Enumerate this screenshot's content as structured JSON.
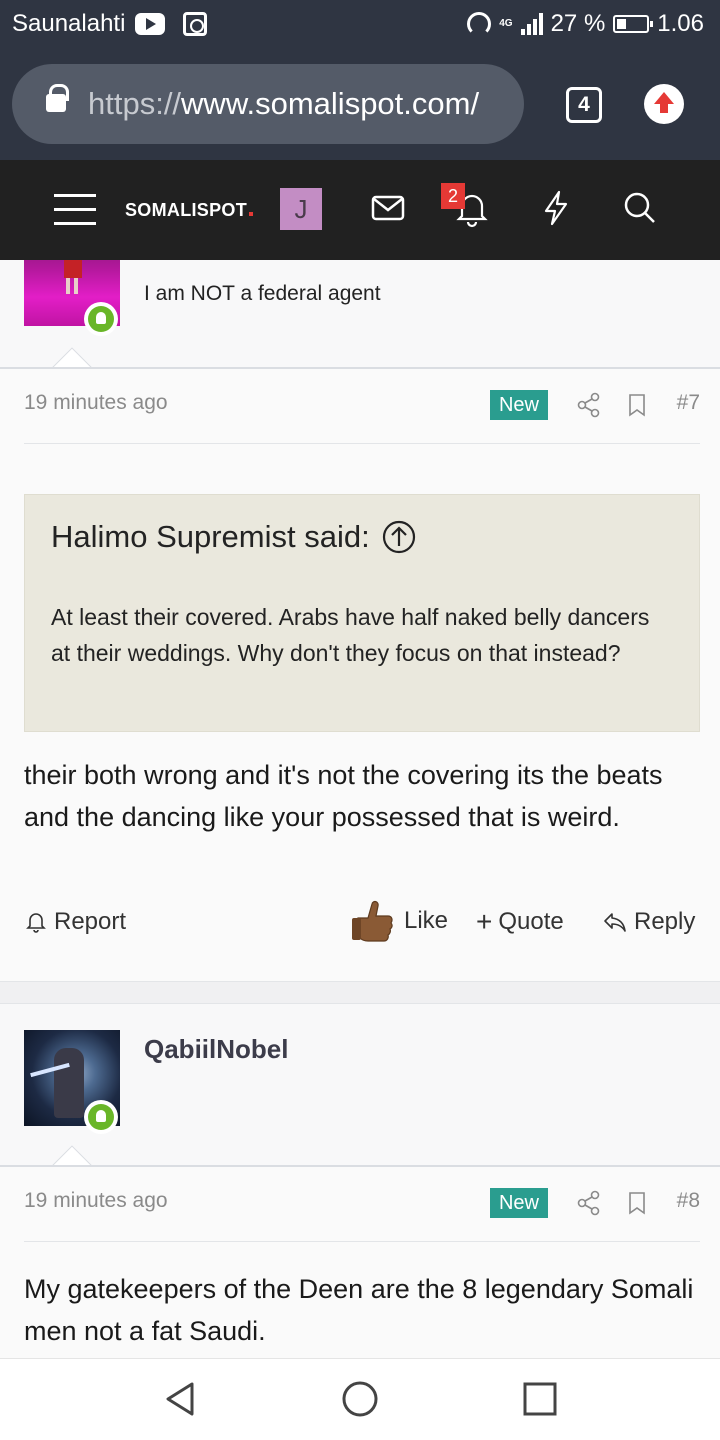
{
  "status_bar": {
    "carrier": "Saunalahti",
    "battery": "27 %",
    "time": "1.06",
    "network": "4G"
  },
  "browser": {
    "url_protocol": "https://",
    "url_host": "www.somalispot.com/",
    "tab_count": "4"
  },
  "site_nav": {
    "logo": "SOMALISPOT",
    "user_initial": "J",
    "alerts_count": "2"
  },
  "previous_post": {
    "user_title": "I am NOT a federal agent",
    "time": "19 minutes ago",
    "new_label": "New",
    "post_number": "#7",
    "quote": {
      "author_line": "Halimo Supremist said:",
      "text": "At least their covered. Arabs have half naked belly dancers at their weddings. Why don't they focus on that instead?"
    },
    "body": "their both wrong and it's not the covering its the beats and the dancing like your possessed that is weird.",
    "actions": {
      "report": "Report",
      "like": "Like",
      "quote": "Quote",
      "reply": "Reply"
    }
  },
  "next_post": {
    "username": "QabiilNobel",
    "time": "19 minutes ago",
    "new_label": "New",
    "post_number": "#8",
    "body": "My gatekeepers of the Deen are the 8 legendary Somali men not a fat Saudi."
  },
  "colors": {
    "status_bar_bg": "#2f3542",
    "site_nav_bg": "#212121",
    "new_badge": "#2a9d8f",
    "alert_badge": "#e53935",
    "quote_bg": "#eae8dd",
    "online_dot": "#69b628"
  }
}
